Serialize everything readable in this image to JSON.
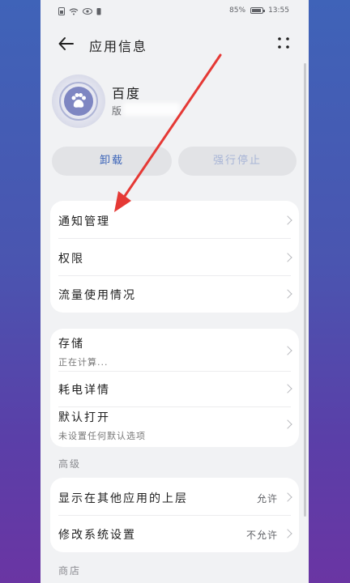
{
  "status": {
    "battery": "85%",
    "battery_level": 0.85,
    "time": "13:55"
  },
  "header": {
    "title": "应用信息"
  },
  "app": {
    "name": "百度",
    "version_prefix": "版"
  },
  "buttons": {
    "uninstall": "卸载",
    "force_stop": "强行停止"
  },
  "list1": [
    {
      "label": "通知管理"
    },
    {
      "label": "权限"
    },
    {
      "label": "流量使用情况"
    }
  ],
  "list2": {
    "storage": {
      "label": "存储",
      "sub": "正在计算..."
    },
    "power": {
      "label": "耗电详情"
    },
    "default_open": {
      "label": "默认打开",
      "sub": "未设置任何默认选项"
    }
  },
  "advanced": {
    "title": "高级",
    "overlay": {
      "label": "显示在其他应用的上层",
      "value": "允许"
    },
    "modify": {
      "label": "修改系统设置",
      "value": "不允许"
    }
  },
  "store": {
    "title": "商店"
  },
  "colors": {
    "accent": "#3a63b8",
    "annotation_arrow": "#e53935"
  }
}
